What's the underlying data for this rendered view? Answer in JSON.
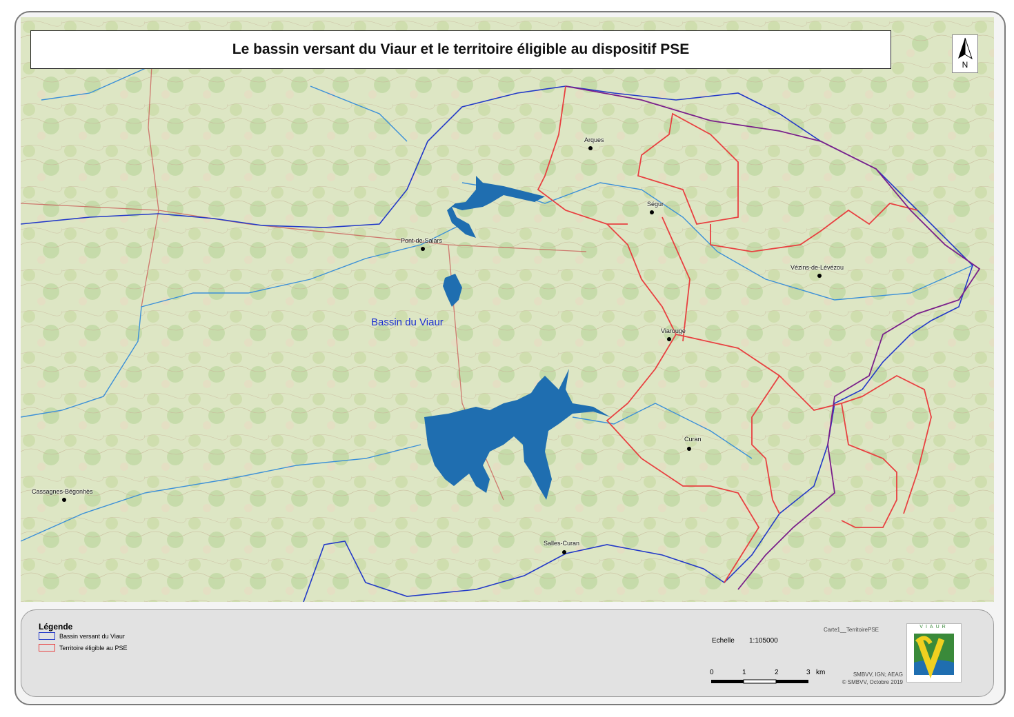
{
  "title": "Le bassin versant du Viaur et le territoire éligible au dispositif PSE",
  "north_arrow": {
    "label": "N"
  },
  "map_labels": {
    "basin": "Bassin du Viaur",
    "places": [
      {
        "id": "arques",
        "name": "Arques"
      },
      {
        "id": "segur",
        "name": "Ségur"
      },
      {
        "id": "pont-de-salars",
        "name": "Pont-de-Salars"
      },
      {
        "id": "vezins",
        "name": "Vézins-de-Lévézou"
      },
      {
        "id": "viarouge",
        "name": "Viarouge"
      },
      {
        "id": "curan",
        "name": "Curan"
      },
      {
        "id": "cassagnes",
        "name": "Cassagnes-Bégonhès"
      },
      {
        "id": "salles-curan",
        "name": "Salles-Curan"
      }
    ]
  },
  "legend": {
    "title": "Légende",
    "items": [
      {
        "label": "Bassin versant du Viaur",
        "color": "#2238c8"
      },
      {
        "label": "Territoire éligible au PSE",
        "color": "#e84040"
      }
    ]
  },
  "scale": {
    "label": "Echelle",
    "ratio": "1:105000",
    "ticks": [
      "0",
      "1",
      "2",
      "3"
    ],
    "unit": "km"
  },
  "map_id": "Carte1__TerritoirePSE",
  "credits": {
    "line1": "SMBVV, IGN; AEAG",
    "line2": "© SMBVV, Octobre 2019"
  },
  "logo": {
    "text": "VIAUR"
  },
  "colors": {
    "basin_boundary": "#2238c8",
    "pse_boundary": "#e84040",
    "park_boundary": "#7a1f8a",
    "lake": "#1f6eb0",
    "river": "#3a8fd8"
  }
}
